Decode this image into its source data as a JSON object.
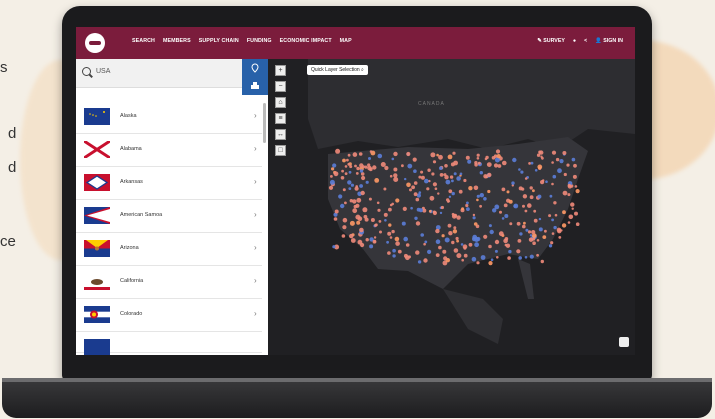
{
  "side_text": [
    "s",
    "d",
    "d",
    "ce"
  ],
  "header": {
    "nav": [
      "SEARCH",
      "MEMBERS",
      "SUPPLY CHAIN",
      "FUNDING",
      "ECONOMIC IMPACT",
      "MAP"
    ],
    "survey": "SURVEY",
    "sign_in": "SIGN IN"
  },
  "search": {
    "value": "USA"
  },
  "states": [
    {
      "label": "Alaska",
      "flag": "alaska"
    },
    {
      "label": "Alabama",
      "flag": "alabama"
    },
    {
      "label": "Arkansas",
      "flag": "arkansas"
    },
    {
      "label": "American Samoa",
      "flag": "american-samoa"
    },
    {
      "label": "Arizona",
      "flag": "arizona"
    },
    {
      "label": "California",
      "flag": "california"
    },
    {
      "label": "Colorado",
      "flag": "colorado"
    }
  ],
  "map": {
    "quick_selection": "Quick Layer Selection",
    "canada_label": "CANADA",
    "tool_icons": [
      "zoom-in-icon",
      "zoom-out-icon",
      "home-icon",
      "layers-icon",
      "measure-icon",
      "fullscreen-icon"
    ],
    "marker_colors": [
      "#f08a7a",
      "#5b7dd8",
      "#ff9966"
    ]
  },
  "colors": {
    "brand": "#7b1c3c",
    "accent": "#2861a9"
  }
}
